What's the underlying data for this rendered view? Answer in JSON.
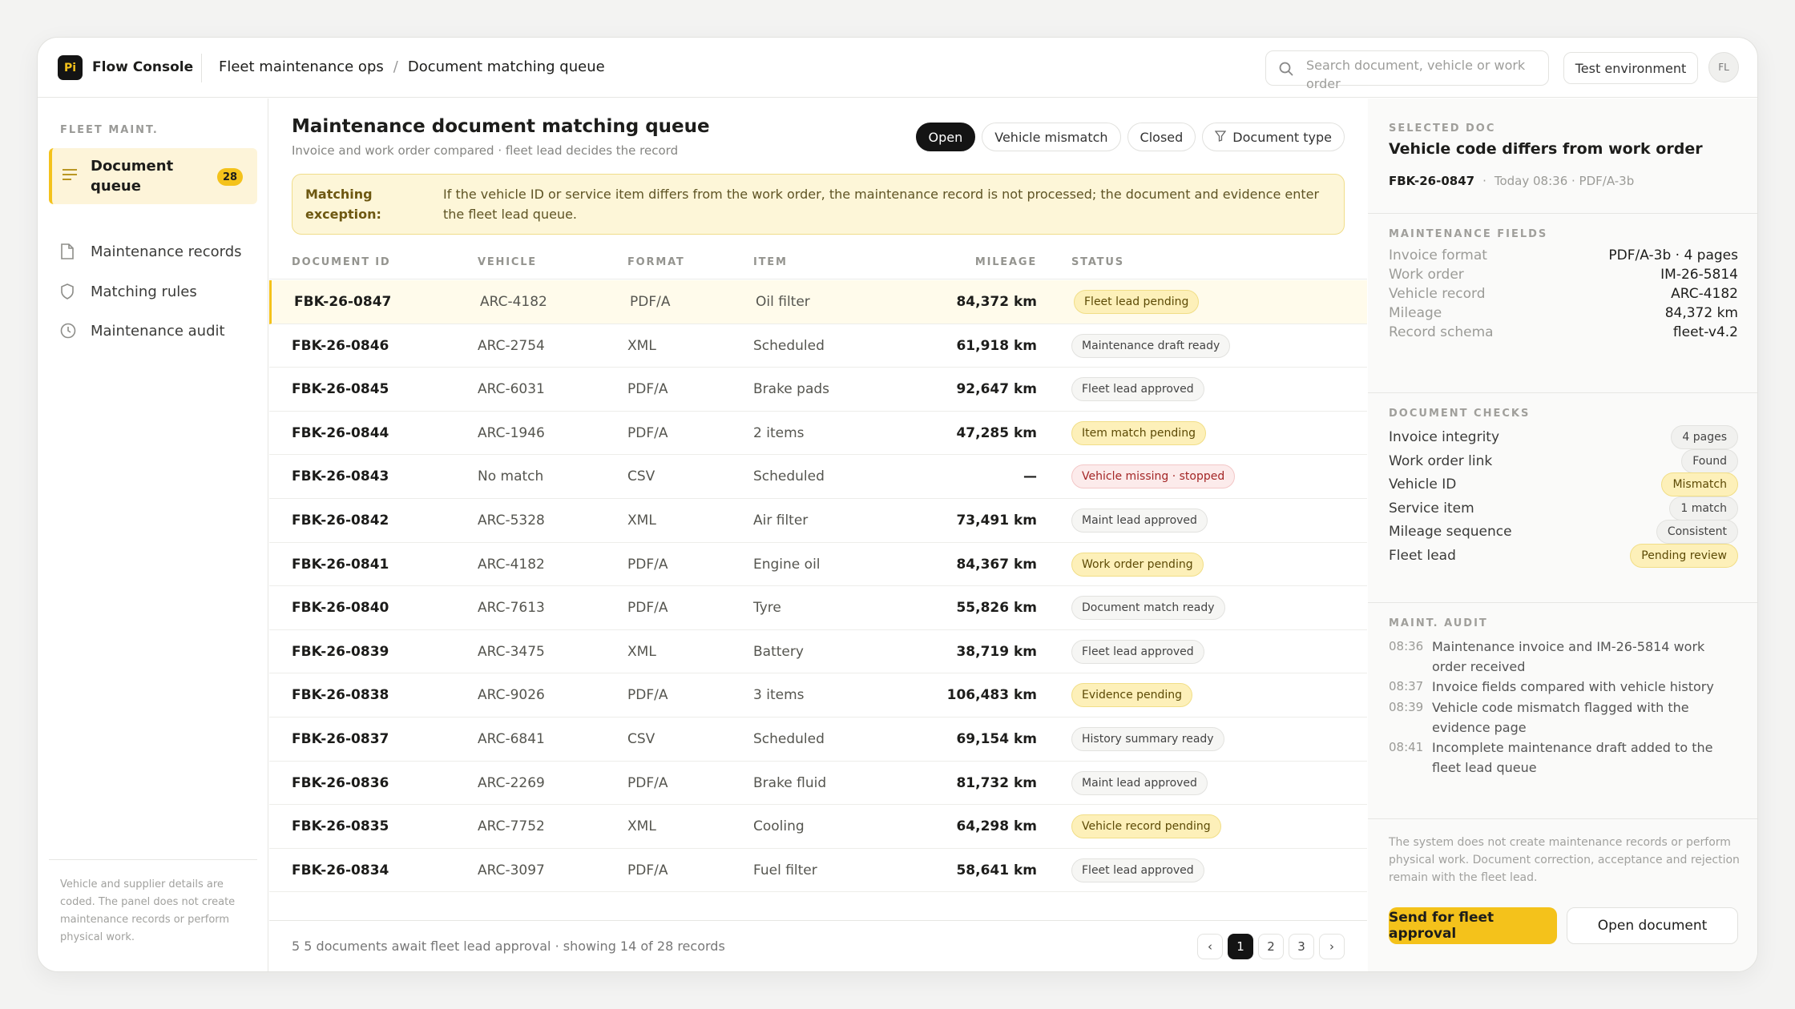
{
  "app": {
    "logo_text": "Pi",
    "name": "Flow Console"
  },
  "breadcrumb": {
    "parent": "Fleet maintenance ops",
    "separator": "/",
    "current": "Document matching queue"
  },
  "search": {
    "placeholder": "Search document, vehicle or work order",
    "icon": "search-icon"
  },
  "header": {
    "env_label": "Test environment",
    "avatar_initials": "FL"
  },
  "sidebar": {
    "title": "FLEET MAINT.",
    "items": [
      {
        "label": "Document queue",
        "icon": "list-icon",
        "badge": "28",
        "active": true
      },
      {
        "label": "Maintenance records",
        "icon": "document-icon"
      },
      {
        "label": "Matching rules",
        "icon": "shield-icon"
      },
      {
        "label": "Maintenance audit",
        "icon": "clock-icon"
      }
    ],
    "footer_note": "Vehicle and supplier details are coded. The panel does not create maintenance records or perform physical work."
  },
  "main": {
    "title": "Maintenance document matching queue",
    "subtitle": "Invoice and work order compared · fleet lead decides the record",
    "filters": [
      {
        "label": "Open",
        "active": true
      },
      {
        "label": "Vehicle mismatch"
      },
      {
        "label": "Closed"
      },
      {
        "label": "Document type",
        "icon": "filter-icon"
      }
    ],
    "alert": {
      "label": "Matching exception:",
      "text": "If the vehicle ID or service item differs from the work order, the maintenance record is not processed; the document and evidence enter the fleet lead queue."
    },
    "columns": {
      "id": "DOCUMENT ID",
      "vehicle": "VEHICLE",
      "format": "FORMAT",
      "item": "ITEM",
      "mileage": "MILEAGE",
      "status": "STATUS"
    },
    "rows": [
      {
        "id": "FBK-26-0847",
        "vehicle": "ARC-4182",
        "format": "PDF/A",
        "item": "Oil filter",
        "mileage": "84,372 km",
        "status": "Fleet lead pending",
        "tone": "y",
        "selected": true
      },
      {
        "id": "FBK-26-0846",
        "vehicle": "ARC-2754",
        "format": "XML",
        "item": "Scheduled",
        "mileage": "61,918 km",
        "status": "Maintenance draft ready",
        "tone": "n"
      },
      {
        "id": "FBK-26-0845",
        "vehicle": "ARC-6031",
        "format": "PDF/A",
        "item": "Brake pads",
        "mileage": "92,647 km",
        "status": "Fleet lead approved",
        "tone": "n"
      },
      {
        "id": "FBK-26-0844",
        "vehicle": "ARC-1946",
        "format": "PDF/A",
        "item": "2 items",
        "mileage": "47,285 km",
        "status": "Item match pending",
        "tone": "y"
      },
      {
        "id": "FBK-26-0843",
        "vehicle": "No match",
        "format": "CSV",
        "item": "Scheduled",
        "mileage": "—",
        "status": "Vehicle missing · stopped",
        "tone": "r"
      },
      {
        "id": "FBK-26-0842",
        "vehicle": "ARC-5328",
        "format": "XML",
        "item": "Air filter",
        "mileage": "73,491 km",
        "status": "Maint lead approved",
        "tone": "n"
      },
      {
        "id": "FBK-26-0841",
        "vehicle": "ARC-4182",
        "format": "PDF/A",
        "item": "Engine oil",
        "mileage": "84,367 km",
        "status": "Work order pending",
        "tone": "y"
      },
      {
        "id": "FBK-26-0840",
        "vehicle": "ARC-7613",
        "format": "PDF/A",
        "item": "Tyre",
        "mileage": "55,826 km",
        "status": "Document match ready",
        "tone": "n"
      },
      {
        "id": "FBK-26-0839",
        "vehicle": "ARC-3475",
        "format": "XML",
        "item": "Battery",
        "mileage": "38,719 km",
        "status": "Fleet lead approved",
        "tone": "n"
      },
      {
        "id": "FBK-26-0838",
        "vehicle": "ARC-9026",
        "format": "PDF/A",
        "item": "3 items",
        "mileage": "106,483 km",
        "status": "Evidence pending",
        "tone": "y"
      },
      {
        "id": "FBK-26-0837",
        "vehicle": "ARC-6841",
        "format": "CSV",
        "item": "Scheduled",
        "mileage": "69,154 km",
        "status": "History summary ready",
        "tone": "n"
      },
      {
        "id": "FBK-26-0836",
        "vehicle": "ARC-2269",
        "format": "PDF/A",
        "item": "Brake fluid",
        "mileage": "81,732 km",
        "status": "Maint lead approved",
        "tone": "n"
      },
      {
        "id": "FBK-26-0835",
        "vehicle": "ARC-7752",
        "format": "XML",
        "item": "Cooling",
        "mileage": "64,298 km",
        "status": "Vehicle record pending",
        "tone": "y"
      },
      {
        "id": "FBK-26-0834",
        "vehicle": "ARC-3097",
        "format": "PDF/A",
        "item": "Fuel filter",
        "mileage": "58,641 km",
        "status": "Fleet lead approved",
        "tone": "n"
      }
    ],
    "footer": {
      "summary": "5 5 documents await fleet lead approval · showing 14 of 28 records",
      "pages": [
        "1",
        "2",
        "3"
      ],
      "prev": "‹",
      "next": "›"
    }
  },
  "panel": {
    "caption": "SELECTED DOC",
    "title": "Vehicle code differs from work order",
    "doc_id": "FBK-26-0847",
    "meta": "Today 08:36 · PDF/A-3b",
    "fields_caption": "MAINTENANCE FIELDS",
    "fields": [
      {
        "k": "Invoice format",
        "v": "PDF/A-3b · 4 pages"
      },
      {
        "k": "Work order",
        "v": "IM-26-5814"
      },
      {
        "k": "Vehicle record",
        "v": "ARC-4182"
      },
      {
        "k": "Mileage",
        "v": "84,372 km"
      },
      {
        "k": "Record schema",
        "v": "fleet-v4.2"
      }
    ],
    "checks_caption": "DOCUMENT CHECKS",
    "checks": [
      {
        "k": "Invoice integrity",
        "v": "4 pages",
        "tone": "n"
      },
      {
        "k": "Work order link",
        "v": "Found",
        "tone": "n"
      },
      {
        "k": "Vehicle ID",
        "v": "Mismatch",
        "tone": "y"
      },
      {
        "k": "Service item",
        "v": "1 match",
        "tone": "n"
      },
      {
        "k": "Mileage sequence",
        "v": "Consistent",
        "tone": "n"
      },
      {
        "k": "Fleet lead",
        "v": "Pending review",
        "tone": "y"
      }
    ],
    "audit_caption": "MAINT. AUDIT",
    "audit": [
      {
        "t": "08:36",
        "text": "Maintenance invoice and IM-26-5814 work order received"
      },
      {
        "t": "08:37",
        "text": "Invoice fields compared with vehicle history"
      },
      {
        "t": "08:39",
        "text": "Vehicle code mismatch flagged with the evidence page"
      },
      {
        "t": "08:41",
        "text": "Incomplete maintenance draft added to the fleet lead queue"
      }
    ],
    "note": "The system does not create maintenance records or perform physical work. Document correction, acceptance and rejection remain with the fleet lead.",
    "primary_btn": "Send for fleet approval",
    "secondary_btn": "Open document"
  },
  "colors": {
    "accent": "#f4c21b",
    "dark": "#141414",
    "warn_bg": "#fdf0b9",
    "error_text": "#a42626"
  }
}
